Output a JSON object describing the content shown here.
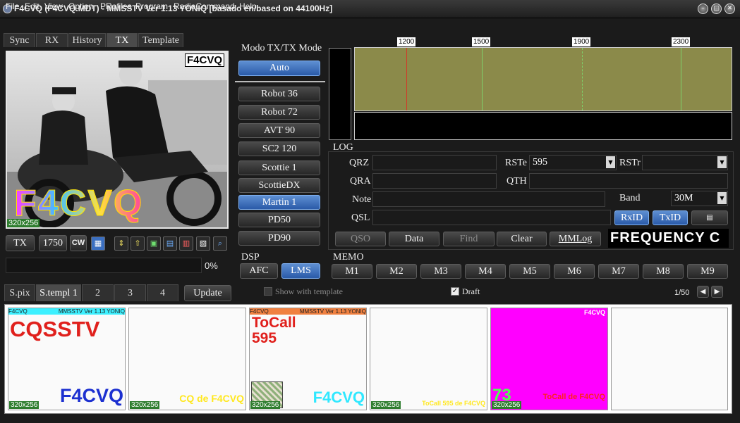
{
  "window": {
    "title": "F4CVQ (F4CVQ.MDT) - MMSSTV Ver 1.13 YONIQ [basado en/based on 44100Hz]"
  },
  "menu": [
    "File",
    "Edit",
    "View",
    "Option",
    "PRofiles",
    "Program",
    "RadioCommand",
    "Help"
  ],
  "tabs": [
    "Sync",
    "RX",
    "History",
    "TX",
    "Template"
  ],
  "tx_image": {
    "callsign_corner": "F4CVQ",
    "callsign_big": "F4CVQ",
    "size": "320x256"
  },
  "tx_controls": {
    "tx": "TX",
    "freq": "1750",
    "cw": "CW",
    "progress": "0%"
  },
  "bottom_tabs": [
    "S.pix",
    "S.templ 1",
    "2",
    "3",
    "4"
  ],
  "update": "Update",
  "mode": {
    "header": "Modo TX/TX Mode",
    "auto": "Auto",
    "modes": [
      "Robot 36",
      "Robot 72",
      "AVT 90",
      "SC2 120",
      "Scottie 1",
      "ScottieDX",
      "Martin 1",
      "PD50",
      "PD90"
    ],
    "active": "Martin 1"
  },
  "dsp": {
    "header": "DSP",
    "afc": "AFC",
    "lms": "LMS"
  },
  "show_template": "Show with template",
  "draft": "Draft",
  "spectrum": {
    "ticks": [
      "1200",
      "1500",
      "1900",
      "2300"
    ]
  },
  "log": {
    "header": "LOG",
    "qrz_label": "QRZ",
    "qrz": "",
    "rste_label": "RSTe",
    "rste": "595",
    "rstr_label": "RSTr",
    "rstr": "",
    "qra_label": "QRA",
    "qra": "",
    "qth_label": "QTH",
    "qth": "",
    "note_label": "Note",
    "note": "",
    "band_label": "Band",
    "band": "30M",
    "qsl_label": "QSL",
    "qsl": "",
    "rxid": "RxID",
    "txid": "TxID",
    "qso": "QSO",
    "data": "Data",
    "find": "Find",
    "clear": "Clear",
    "mmlog": "MMLog",
    "freq_display": "FREQUENCY C"
  },
  "memo": {
    "header": "MEMO",
    "buttons": [
      "M1",
      "M2",
      "M3",
      "M4",
      "M5",
      "M6",
      "M7",
      "M8",
      "M9"
    ]
  },
  "page": "1/50",
  "thumbs": [
    {
      "head_left": "F4CVQ",
      "head_right": "MMSSTV Ver 1.13 YONIQ",
      "main": "CQSSTV",
      "bottom": "F4CVQ",
      "size": "320x256"
    },
    {
      "bottom": "CQ de F4CVQ",
      "size": "320x256"
    },
    {
      "head_left": "F4CVQ",
      "head_right": "MMSSTV Ver 1.13 YONIQ",
      "main": "ToCall",
      "rst": "595",
      "bottom": "F4CVQ",
      "size": "320x256"
    },
    {
      "bottom": "ToCall 595 de F4CVQ",
      "size": "320x256"
    },
    {
      "corner": "F4CVQ",
      "num": "73",
      "bottom": "ToCall de F4CVQ",
      "size": "320x256"
    },
    {}
  ],
  "colors": {
    "spectrum_bg": "#8b8a4a",
    "mark_red": "#d03a2a",
    "mark_green": "#7fd06a",
    "blue_btn": "#3b6fc0"
  }
}
